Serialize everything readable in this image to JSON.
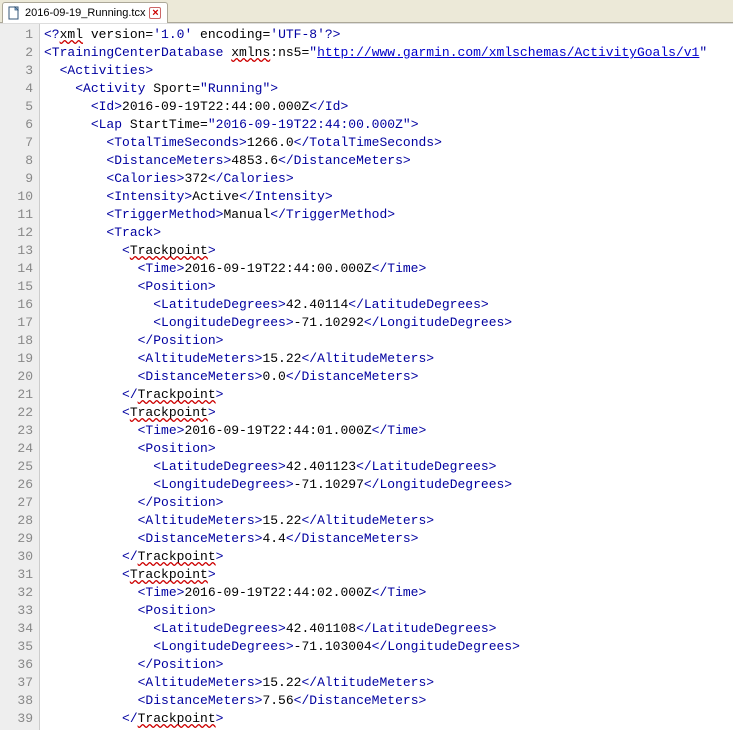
{
  "tab": {
    "filename": "2016-09-19_Running.tcx",
    "close_glyph": "×"
  },
  "lines": [
    {
      "n": "1",
      "indent": 0,
      "html": "<span class='tag'>&lt;?</span><span class='squiggle'>xml</span> version=<span class='attr-val'>'1.0'</span> encoding=<span class='attr-val'>'UTF-8'</span><span class='tag'>?&gt;</span>"
    },
    {
      "n": "2",
      "indent": 0,
      "html": "<span class='tag'>&lt;TrainingCenterDatabase</span> <span class='squiggle'>xmlns</span>:ns5=<span class='attr-val'>\"</span><span class='link'>http://www.garmin.com/xmlschemas/ActivityGoals/v1</span><span class='attr-val'>\"</span>"
    },
    {
      "n": "3",
      "indent": 1,
      "html": "<span class='tag'>&lt;Activities&gt;</span>"
    },
    {
      "n": "4",
      "indent": 2,
      "html": "<span class='tag'>&lt;Activity</span> Sport=<span class='attr-val'>\"Running\"</span><span class='tag'>&gt;</span>"
    },
    {
      "n": "5",
      "indent": 3,
      "html": "<span class='tag'>&lt;Id&gt;</span>2016-09-19T22:44:00.000Z<span class='tag'>&lt;/Id&gt;</span>"
    },
    {
      "n": "6",
      "indent": 3,
      "html": "<span class='tag'>&lt;Lap</span> StartTime=<span class='attr-val'>\"2016-09-19T22:44:00.000Z\"</span><span class='tag'>&gt;</span>"
    },
    {
      "n": "7",
      "indent": 4,
      "html": "<span class='tag'>&lt;TotalTimeSeconds&gt;</span>1266.0<span class='tag'>&lt;/TotalTimeSeconds&gt;</span>"
    },
    {
      "n": "8",
      "indent": 4,
      "html": "<span class='tag'>&lt;DistanceMeters&gt;</span>4853.6<span class='tag'>&lt;/DistanceMeters&gt;</span>"
    },
    {
      "n": "9",
      "indent": 4,
      "html": "<span class='tag'>&lt;Calories&gt;</span>372<span class='tag'>&lt;/Calories&gt;</span>"
    },
    {
      "n": "10",
      "indent": 4,
      "html": "<span class='tag'>&lt;Intensity&gt;</span>Active<span class='tag'>&lt;/Intensity&gt;</span>"
    },
    {
      "n": "11",
      "indent": 4,
      "html": "<span class='tag'>&lt;TriggerMethod&gt;</span>Manual<span class='tag'>&lt;/TriggerMethod&gt;</span>"
    },
    {
      "n": "12",
      "indent": 4,
      "html": "<span class='tag'>&lt;Track&gt;</span>"
    },
    {
      "n": "13",
      "indent": 5,
      "html": "<span class='tag'>&lt;</span><span class='squiggle'>Trackpoint</span><span class='tag'>&gt;</span>"
    },
    {
      "n": "14",
      "indent": 6,
      "html": "<span class='tag'>&lt;Time&gt;</span>2016-09-19T22:44:00.000Z<span class='tag'>&lt;/Time&gt;</span>"
    },
    {
      "n": "15",
      "indent": 6,
      "html": "<span class='tag'>&lt;Position&gt;</span>"
    },
    {
      "n": "16",
      "indent": 7,
      "html": "<span class='tag'>&lt;LatitudeDegrees&gt;</span>42.40114<span class='tag'>&lt;/LatitudeDegrees&gt;</span>"
    },
    {
      "n": "17",
      "indent": 7,
      "html": "<span class='tag'>&lt;LongitudeDegrees&gt;</span>-71.10292<span class='tag'>&lt;/LongitudeDegrees&gt;</span>"
    },
    {
      "n": "18",
      "indent": 6,
      "html": "<span class='tag'>&lt;/Position&gt;</span>"
    },
    {
      "n": "19",
      "indent": 6,
      "html": "<span class='tag'>&lt;AltitudeMeters&gt;</span>15.22<span class='tag'>&lt;/AltitudeMeters&gt;</span>"
    },
    {
      "n": "20",
      "indent": 6,
      "html": "<span class='tag'>&lt;DistanceMeters&gt;</span>0.0<span class='tag'>&lt;/DistanceMeters&gt;</span>"
    },
    {
      "n": "21",
      "indent": 5,
      "html": "<span class='tag'>&lt;/</span><span class='squiggle'>Trackpoint</span><span class='tag'>&gt;</span>"
    },
    {
      "n": "22",
      "indent": 5,
      "html": "<span class='tag'>&lt;</span><span class='squiggle'>Trackpoint</span><span class='tag'>&gt;</span>"
    },
    {
      "n": "23",
      "indent": 6,
      "html": "<span class='tag'>&lt;Time&gt;</span>2016-09-19T22:44:01.000Z<span class='tag'>&lt;/Time&gt;</span>"
    },
    {
      "n": "24",
      "indent": 6,
      "html": "<span class='tag'>&lt;Position&gt;</span>"
    },
    {
      "n": "25",
      "indent": 7,
      "html": "<span class='tag'>&lt;LatitudeDegrees&gt;</span>42.401123<span class='tag'>&lt;/LatitudeDegrees&gt;</span>"
    },
    {
      "n": "26",
      "indent": 7,
      "html": "<span class='tag'>&lt;LongitudeDegrees&gt;</span>-71.10297<span class='tag'>&lt;/LongitudeDegrees&gt;</span>"
    },
    {
      "n": "27",
      "indent": 6,
      "html": "<span class='tag'>&lt;/Position&gt;</span>"
    },
    {
      "n": "28",
      "indent": 6,
      "html": "<span class='tag'>&lt;AltitudeMeters&gt;</span>15.22<span class='tag'>&lt;/AltitudeMeters&gt;</span>"
    },
    {
      "n": "29",
      "indent": 6,
      "html": "<span class='tag'>&lt;DistanceMeters&gt;</span>4.4<span class='tag'>&lt;/DistanceMeters&gt;</span>"
    },
    {
      "n": "30",
      "indent": 5,
      "html": "<span class='tag'>&lt;/</span><span class='squiggle'>Trackpoint</span><span class='tag'>&gt;</span>"
    },
    {
      "n": "31",
      "indent": 5,
      "html": "<span class='tag'>&lt;</span><span class='squiggle'>Trackpoint</span><span class='tag'>&gt;</span>"
    },
    {
      "n": "32",
      "indent": 6,
      "html": "<span class='tag'>&lt;Time&gt;</span>2016-09-19T22:44:02.000Z<span class='tag'>&lt;/Time&gt;</span>"
    },
    {
      "n": "33",
      "indent": 6,
      "html": "<span class='tag'>&lt;Position&gt;</span>"
    },
    {
      "n": "34",
      "indent": 7,
      "html": "<span class='tag'>&lt;LatitudeDegrees&gt;</span>42.401108<span class='tag'>&lt;/LatitudeDegrees&gt;</span>"
    },
    {
      "n": "35",
      "indent": 7,
      "html": "<span class='tag'>&lt;LongitudeDegrees&gt;</span>-71.103004<span class='tag'>&lt;/LongitudeDegrees&gt;</span>"
    },
    {
      "n": "36",
      "indent": 6,
      "html": "<span class='tag'>&lt;/Position&gt;</span>"
    },
    {
      "n": "37",
      "indent": 6,
      "html": "<span class='tag'>&lt;AltitudeMeters&gt;</span>15.22<span class='tag'>&lt;/AltitudeMeters&gt;</span>"
    },
    {
      "n": "38",
      "indent": 6,
      "html": "<span class='tag'>&lt;DistanceMeters&gt;</span>7.56<span class='tag'>&lt;/DistanceMeters&gt;</span>"
    },
    {
      "n": "39",
      "indent": 5,
      "html": "<span class='tag'>&lt;/</span><span class='squiggle'>Trackpoint</span><span class='tag'>&gt;</span>"
    }
  ]
}
